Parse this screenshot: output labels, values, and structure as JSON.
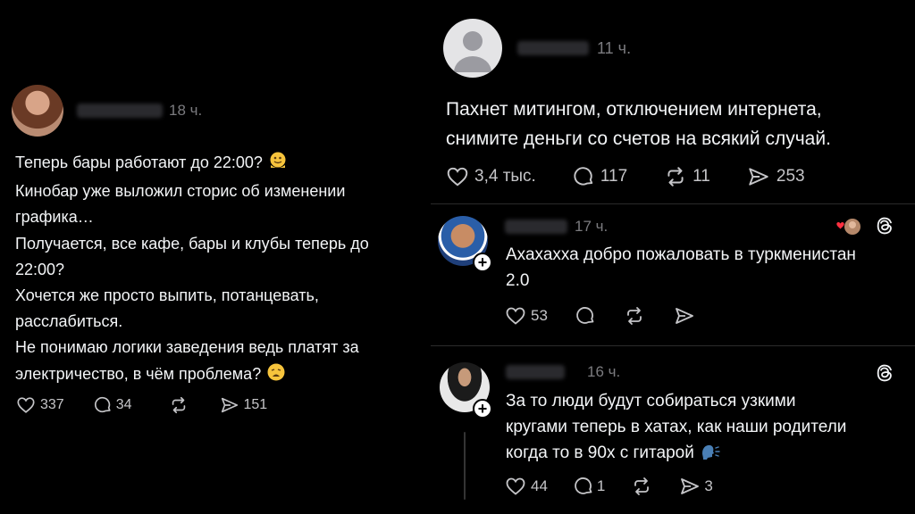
{
  "left_post": {
    "username_blurred": "lermuzya",
    "time": "18 ч.",
    "lines": [
      "Теперь бары работают до 22:00?",
      "Кинобар уже выложил сторис об изменении",
      "графика…",
      "Получается, все кафе, бары и клубы теперь до",
      "22:00?",
      "Хочется же просто выпить, потанцевать,",
      "расслабиться.",
      "Не понимаю логики заведения ведь платят за",
      "электричество, в чём проблема?"
    ],
    "likes": "337",
    "replies": "34",
    "shares": "151"
  },
  "right_post": {
    "username_blurred": "adinkaa",
    "time": "11 ч.",
    "lines": [
      "Пахнет митингом, отключением интернета,",
      "снимите деньги со счетов на всякий случай."
    ],
    "likes": "3,4 тыс.",
    "replies": "117",
    "reposts": "11",
    "shares": "253"
  },
  "reply1": {
    "username_blurred": "matiolle",
    "time": "17 ч.",
    "lines": [
      "Ахахахха добро пожаловать в туркменистан",
      "2.0"
    ],
    "likes": "53"
  },
  "reply2": {
    "username_blurred": "nihsayne",
    "time": "16 ч.",
    "lines": [
      "За то люди будут собираться узкими",
      "кругами теперь в хатах, как наши родители",
      "когда то в 90х с гитарой"
    ],
    "likes": "44",
    "replies": "1",
    "shares": "3"
  },
  "colors": {
    "background": "#000000",
    "text": "#f3f5f7",
    "muted": "#7b7b7f",
    "heart_red": "#ff3040"
  }
}
